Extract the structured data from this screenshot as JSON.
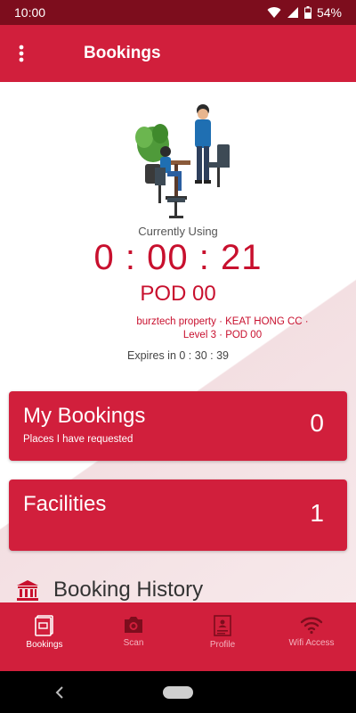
{
  "status_bar": {
    "time": "10:00",
    "battery": "54%"
  },
  "app_bar": {
    "title": "Bookings",
    "menu_icon": "more-vert-icon"
  },
  "current": {
    "label": "Currently Using",
    "timer": "0 : 00 : 21",
    "pod": "POD 00",
    "location": "burztech property · KEAT HONG CC · Level 3 · POD 00",
    "expires": "Expires in 0 : 30 : 39"
  },
  "cards": {
    "bookings": {
      "title": "My Bookings",
      "subtitle": "Places I have requested",
      "count": "0"
    },
    "facilities": {
      "title": "Facilities",
      "count": "1"
    }
  },
  "history": {
    "title": "Booking History",
    "icon": "institution-icon"
  },
  "bottom_nav": {
    "items": [
      {
        "label": "Bookings",
        "icon": "bookings-icon",
        "active": true
      },
      {
        "label": "Scan",
        "icon": "camera-icon",
        "active": false
      },
      {
        "label": "Profile",
        "icon": "profile-document-icon",
        "active": false
      },
      {
        "label": "Wifi Access",
        "icon": "wifi-icon",
        "active": false
      }
    ]
  },
  "colors": {
    "primary": "#d11f3c",
    "status_bar": "#7d0d1d",
    "accent_text": "#c8102e"
  }
}
